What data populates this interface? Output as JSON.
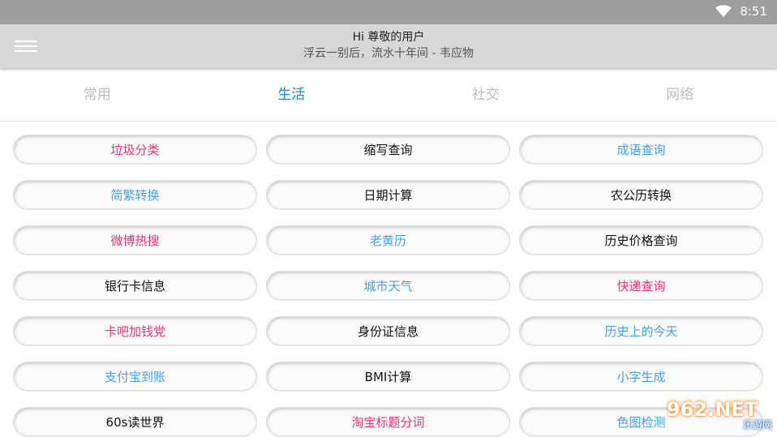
{
  "status_bar": {
    "time": "8:51",
    "wifi_icon": "wifi-icon"
  },
  "header": {
    "title": "Hi 尊敬的用户",
    "subtitle": "浮云一别后，流水十年间 - 韦应物",
    "menu_icon": "hamburger-menu-icon"
  },
  "tabs": [
    {
      "label": "常用",
      "active": false
    },
    {
      "label": "生活",
      "active": true
    },
    {
      "label": "社交",
      "active": false
    },
    {
      "label": "网络",
      "active": false
    }
  ],
  "colors": {
    "pink": "#e8326a",
    "blue": "#4a9fe0",
    "black": "#111111",
    "tab_active": "#1a88d8",
    "tab_inactive": "#bdbdbd"
  },
  "items": [
    {
      "label": "垃圾分类",
      "color": "pink"
    },
    {
      "label": "缩写查询",
      "color": "black"
    },
    {
      "label": "成语查询",
      "color": "blue"
    },
    {
      "label": "简繁转换",
      "color": "blue"
    },
    {
      "label": "日期计算",
      "color": "black"
    },
    {
      "label": "农公历转换",
      "color": "black"
    },
    {
      "label": "微博热搜",
      "color": "pink"
    },
    {
      "label": "老黄历",
      "color": "blue"
    },
    {
      "label": "历史价格查询",
      "color": "black"
    },
    {
      "label": "银行卡信息",
      "color": "black"
    },
    {
      "label": "城市天气",
      "color": "blue"
    },
    {
      "label": "快递查询",
      "color": "pink"
    },
    {
      "label": "卡吧加钱党",
      "color": "pink"
    },
    {
      "label": "身份证信息",
      "color": "black"
    },
    {
      "label": "历史上的今天",
      "color": "blue"
    },
    {
      "label": "支付宝到账",
      "color": "blue"
    },
    {
      "label": "BMI计算",
      "color": "black"
    },
    {
      "label": "小字生成",
      "color": "blue"
    },
    {
      "label": "60s读世界",
      "color": "black"
    },
    {
      "label": "淘宝标题分词",
      "color": "pink"
    },
    {
      "label": "色图检测",
      "color": "blue"
    }
  ],
  "watermark": {
    "top": "962.NET",
    "bottom": "乐游网"
  }
}
